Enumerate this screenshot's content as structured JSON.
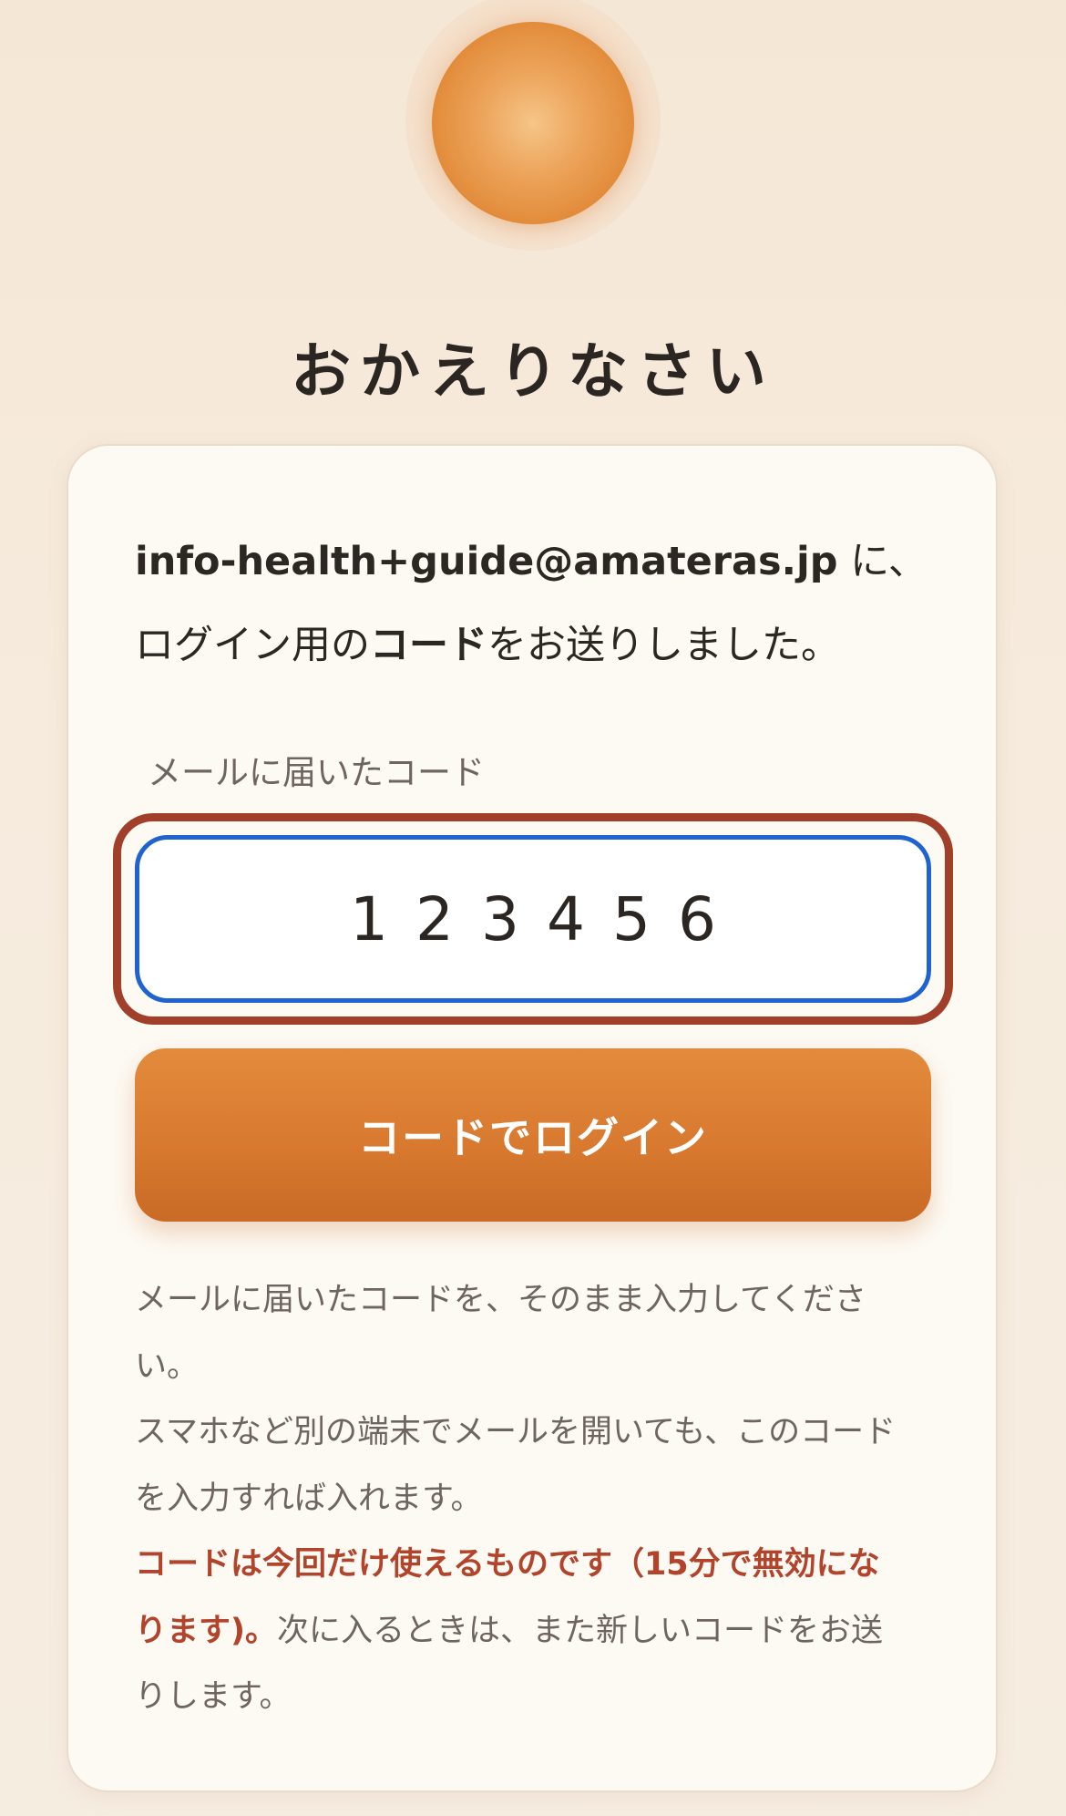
{
  "header": {
    "title": "おかえりなさい"
  },
  "intro": {
    "email": "info-health+guide@amateras.jp",
    "email_suffix": " に、",
    "line2_prefix": "ログイン用の",
    "line2_strong": "コード",
    "line2_suffix": "をお送りしました。"
  },
  "code_field": {
    "label": "メールに届いたコード",
    "value": "123456"
  },
  "login_button": {
    "label": "コードでログイン"
  },
  "help": {
    "line1": "メールに届いたコードを、そのまま入力してくださ",
    "line2": "い。",
    "line3": "スマホなど別の端末でメールを開いても、このコード",
    "line4": "を入力すれば入れます。",
    "warn_line5": "コードは今回だけ使えるものです（15分で無効にな",
    "warn_line6": "ります)。",
    "line6_rest": "次に入るときは、また新しいコードをお送",
    "line7": "りします。"
  },
  "colors": {
    "accent": "#d7782e",
    "focus_ring": "#1e63cf",
    "outline": "#a23f2b",
    "warning_text": "#b2442c"
  }
}
